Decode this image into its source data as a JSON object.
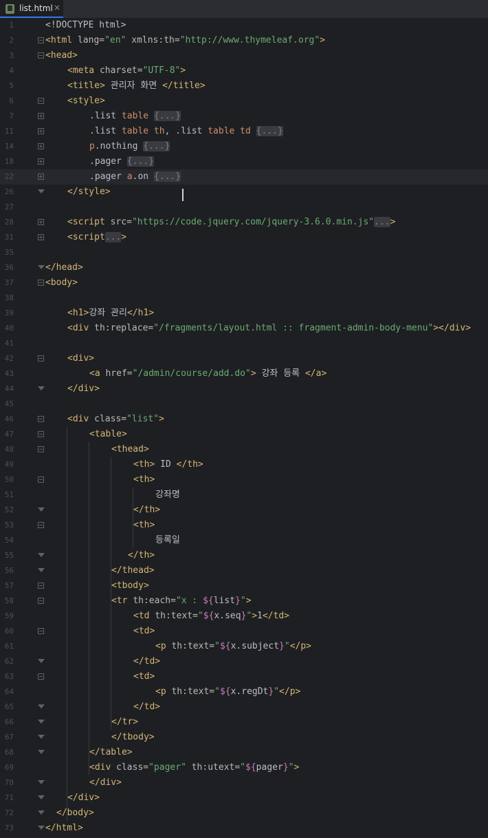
{
  "tab": {
    "filename": "list.html",
    "close": "×"
  },
  "lines": [
    {
      "n": "1",
      "segs": [
        [
          "t-text",
          "<!DOCTYPE html>"
        ]
      ],
      "indent": 0,
      "fold": ""
    },
    {
      "n": "2",
      "segs": [
        [
          "t-tag",
          "<html "
        ],
        [
          "t-attr",
          "lang="
        ],
        [
          "t-val",
          "\"en\""
        ],
        [
          "t-attr",
          " xmlns:th="
        ],
        [
          "t-val",
          "\"http://www.thymeleaf.org\""
        ],
        [
          "t-tag",
          ">"
        ]
      ],
      "indent": 0,
      "fold": "open"
    },
    {
      "n": "3",
      "segs": [
        [
          "t-tag",
          "<head>"
        ]
      ],
      "indent": 0,
      "fold": "open"
    },
    {
      "n": "4",
      "segs": [
        [
          "t-tag",
          "<meta "
        ],
        [
          "t-attr",
          "charset="
        ],
        [
          "t-val",
          "\"UTF-8\""
        ],
        [
          "t-tag",
          ">"
        ]
      ],
      "indent": 1,
      "fold": ""
    },
    {
      "n": "5",
      "segs": [
        [
          "t-tag",
          "<title>"
        ],
        [
          "t-text",
          " 관리자 화면 "
        ],
        [
          "t-tag",
          "</title>"
        ]
      ],
      "indent": 1,
      "fold": ""
    },
    {
      "n": "6",
      "segs": [
        [
          "t-tag",
          "<style>"
        ]
      ],
      "indent": 1,
      "fold": "open"
    },
    {
      "n": "7",
      "segs": [
        [
          "t-cls",
          ".list "
        ],
        [
          "t-kw",
          "table"
        ],
        [
          "t-text",
          " "
        ],
        [
          "t-fold",
          "{...}"
        ]
      ],
      "indent": 2,
      "fold": "closed"
    },
    {
      "n": "11",
      "segs": [
        [
          "t-cls",
          ".list "
        ],
        [
          "t-kw",
          "table th"
        ],
        [
          "t-text",
          ", "
        ],
        [
          "t-cls",
          ".list "
        ],
        [
          "t-kw",
          "table td"
        ],
        [
          "t-text",
          " "
        ],
        [
          "t-fold",
          "{...}"
        ]
      ],
      "indent": 2,
      "fold": "closed"
    },
    {
      "n": "14",
      "segs": [
        [
          "t-kw",
          "p"
        ],
        [
          "t-cls",
          ".nothing"
        ],
        [
          "t-text",
          " "
        ],
        [
          "t-fold",
          "{...}"
        ]
      ],
      "indent": 2,
      "fold": "closed"
    },
    {
      "n": "18",
      "segs": [
        [
          "t-cls",
          ".pager"
        ],
        [
          "t-text",
          " "
        ],
        [
          "t-fold",
          "{...}"
        ]
      ],
      "indent": 2,
      "fold": "closed"
    },
    {
      "n": "22",
      "segs": [
        [
          "t-cls",
          ".pager "
        ],
        [
          "t-kw",
          "a"
        ],
        [
          "t-cls",
          ".on"
        ],
        [
          "t-text",
          " "
        ],
        [
          "t-fold",
          "{...}"
        ]
      ],
      "indent": 2,
      "fold": "closed",
      "current": true
    },
    {
      "n": "26",
      "segs": [
        [
          "t-tag",
          "</style>"
        ]
      ],
      "indent": 1,
      "fold": "end"
    },
    {
      "n": "27",
      "segs": [],
      "indent": 0,
      "fold": ""
    },
    {
      "n": "28",
      "segs": [
        [
          "t-tag",
          "<script "
        ],
        [
          "t-attr",
          "src="
        ],
        [
          "t-val",
          "\"https://code.jquery.com/jquery-3.6.0.min.js\""
        ],
        [
          "t-fold",
          "..."
        ],
        [
          "t-tag",
          ">"
        ]
      ],
      "indent": 1,
      "fold": "closed"
    },
    {
      "n": "31",
      "segs": [
        [
          "t-tag",
          "<script"
        ],
        [
          "t-fold",
          "..."
        ],
        [
          "t-tag",
          ">"
        ]
      ],
      "indent": 1,
      "fold": "closed"
    },
    {
      "n": "35",
      "segs": [],
      "indent": 0,
      "fold": ""
    },
    {
      "n": "36",
      "segs": [
        [
          "t-tag",
          "</head>"
        ]
      ],
      "indent": 0,
      "fold": "end"
    },
    {
      "n": "37",
      "segs": [
        [
          "t-tag",
          "<body>"
        ]
      ],
      "indent": 0,
      "fold": "open"
    },
    {
      "n": "38",
      "segs": [],
      "indent": 0,
      "fold": ""
    },
    {
      "n": "39",
      "segs": [
        [
          "t-tag",
          "<h1>"
        ],
        [
          "t-text",
          "강좌 관리"
        ],
        [
          "t-tag",
          "</h1>"
        ]
      ],
      "indent": 1,
      "fold": ""
    },
    {
      "n": "40",
      "segs": [
        [
          "t-tag",
          "<div "
        ],
        [
          "t-attr",
          "th:replace="
        ],
        [
          "t-val",
          "\"/fragments/layout.html :: fragment-admin-body-menu\""
        ],
        [
          "t-tag",
          "></div>"
        ]
      ],
      "indent": 1,
      "fold": ""
    },
    {
      "n": "41",
      "segs": [],
      "indent": 0,
      "fold": ""
    },
    {
      "n": "42",
      "segs": [
        [
          "t-tag",
          "<div>"
        ]
      ],
      "indent": 1,
      "fold": "open"
    },
    {
      "n": "43",
      "segs": [
        [
          "t-tag",
          "<a "
        ],
        [
          "t-attr",
          "href="
        ],
        [
          "t-val",
          "\"/admin/course/add.do\""
        ],
        [
          "t-tag",
          ">"
        ],
        [
          "t-text",
          " 강좌 등록 "
        ],
        [
          "t-tag",
          "</a>"
        ]
      ],
      "indent": 2,
      "fold": ""
    },
    {
      "n": "44",
      "segs": [
        [
          "t-tag",
          "</div>"
        ]
      ],
      "indent": 1,
      "fold": "end"
    },
    {
      "n": "45",
      "segs": [],
      "indent": 0,
      "fold": ""
    },
    {
      "n": "46",
      "segs": [
        [
          "t-tag",
          "<div "
        ],
        [
          "t-attr",
          "class="
        ],
        [
          "t-val",
          "\"list\""
        ],
        [
          "t-tag",
          ">"
        ]
      ],
      "indent": 1,
      "fold": "open"
    },
    {
      "n": "47",
      "segs": [
        [
          "t-tag",
          "<table>"
        ]
      ],
      "indent": 2,
      "fold": "open"
    },
    {
      "n": "48",
      "segs": [
        [
          "t-tag",
          "<thead>"
        ]
      ],
      "indent": 3,
      "fold": "open"
    },
    {
      "n": "49",
      "segs": [
        [
          "t-tag",
          "<th>"
        ],
        [
          "t-text",
          " ID "
        ],
        [
          "t-tag",
          "</th>"
        ]
      ],
      "indent": 4,
      "fold": ""
    },
    {
      "n": "50",
      "segs": [
        [
          "t-tag",
          "<th>"
        ]
      ],
      "indent": 4,
      "fold": "open"
    },
    {
      "n": "51",
      "segs": [
        [
          "t-text",
          "강좌명"
        ]
      ],
      "indent": 5,
      "fold": ""
    },
    {
      "n": "52",
      "segs": [
        [
          "t-tag",
          "</th>"
        ]
      ],
      "indent": 4,
      "fold": "end"
    },
    {
      "n": "53",
      "segs": [
        [
          "t-tag",
          "<th>"
        ]
      ],
      "indent": 4,
      "fold": "open"
    },
    {
      "n": "54",
      "segs": [
        [
          "t-text",
          "등록일"
        ]
      ],
      "indent": 5,
      "fold": ""
    },
    {
      "n": "55",
      "segs": [
        [
          "t-tag",
          "</th>"
        ]
      ],
      "indent": 3.75,
      "fold": "end"
    },
    {
      "n": "56",
      "segs": [
        [
          "t-tag",
          "</thead>"
        ]
      ],
      "indent": 3,
      "fold": "end"
    },
    {
      "n": "57",
      "segs": [
        [
          "t-tag",
          "<tbody>"
        ]
      ],
      "indent": 3,
      "fold": "open"
    },
    {
      "n": "58",
      "segs": [
        [
          "t-tag",
          "<tr "
        ],
        [
          "t-attr",
          "th:each="
        ],
        [
          "t-val",
          "\"x : "
        ],
        [
          "t-pink",
          "${"
        ],
        [
          "t-text",
          "list"
        ],
        [
          "t-pink",
          "}"
        ],
        [
          "t-val",
          "\""
        ],
        [
          "t-tag",
          ">"
        ]
      ],
      "indent": 3,
      "fold": "open"
    },
    {
      "n": "59",
      "segs": [
        [
          "t-tag",
          "<td "
        ],
        [
          "t-attr",
          "th:text="
        ],
        [
          "t-val",
          "\""
        ],
        [
          "t-pink",
          "${"
        ],
        [
          "t-text",
          "x.seq"
        ],
        [
          "t-pink",
          "}"
        ],
        [
          "t-val",
          "\""
        ],
        [
          "t-tag",
          ">"
        ],
        [
          "t-text",
          "1"
        ],
        [
          "t-tag",
          "</td>"
        ]
      ],
      "indent": 4,
      "fold": ""
    },
    {
      "n": "60",
      "segs": [
        [
          "t-tag",
          "<td>"
        ]
      ],
      "indent": 4,
      "fold": "open"
    },
    {
      "n": "61",
      "segs": [
        [
          "t-tag",
          "<p "
        ],
        [
          "t-attr",
          "th:text="
        ],
        [
          "t-val",
          "\""
        ],
        [
          "t-pink",
          "${"
        ],
        [
          "t-text",
          "x.subject"
        ],
        [
          "t-pink",
          "}"
        ],
        [
          "t-val",
          "\""
        ],
        [
          "t-tag",
          "</p>"
        ]
      ],
      "indent": 5,
      "fold": ""
    },
    {
      "n": "62",
      "segs": [
        [
          "t-tag",
          "</td>"
        ]
      ],
      "indent": 4,
      "fold": "end"
    },
    {
      "n": "63",
      "segs": [
        [
          "t-tag",
          "<td>"
        ]
      ],
      "indent": 4,
      "fold": "open"
    },
    {
      "n": "64",
      "segs": [
        [
          "t-tag",
          "<p "
        ],
        [
          "t-attr",
          "th:text="
        ],
        [
          "t-val",
          "\""
        ],
        [
          "t-pink",
          "${"
        ],
        [
          "t-text",
          "x.regDt"
        ],
        [
          "t-pink",
          "}"
        ],
        [
          "t-val",
          "\""
        ],
        [
          "t-tag",
          "</p>"
        ]
      ],
      "indent": 5,
      "fold": ""
    },
    {
      "n": "65",
      "segs": [
        [
          "t-tag",
          "</td>"
        ]
      ],
      "indent": 4,
      "fold": "end"
    },
    {
      "n": "66",
      "segs": [
        [
          "t-tag",
          "</tr>"
        ]
      ],
      "indent": 3,
      "fold": "end"
    },
    {
      "n": "67",
      "segs": [
        [
          "t-tag",
          "</tbody>"
        ]
      ],
      "indent": 3,
      "fold": "end"
    },
    {
      "n": "68",
      "segs": [
        [
          "t-tag",
          "</table>"
        ]
      ],
      "indent": 2,
      "fold": "end"
    },
    {
      "n": "69",
      "segs": [
        [
          "t-tag",
          "<div "
        ],
        [
          "t-attr",
          "class="
        ],
        [
          "t-val",
          "\"pager\""
        ],
        [
          "t-attr",
          " th:utext="
        ],
        [
          "t-val",
          "\""
        ],
        [
          "t-pink",
          "${"
        ],
        [
          "t-text",
          "pager"
        ],
        [
          "t-pink",
          "}"
        ],
        [
          "t-val",
          "\""
        ],
        [
          "t-tag",
          ">"
        ]
      ],
      "indent": 2,
      "fold": ""
    },
    {
      "n": "70",
      "segs": [
        [
          "t-tag",
          "</div>"
        ]
      ],
      "indent": 2,
      "fold": "end"
    },
    {
      "n": "71",
      "segs": [
        [
          "t-tag",
          "</div>"
        ]
      ],
      "indent": 1,
      "fold": "end"
    },
    {
      "n": "72",
      "segs": [
        [
          "t-tag",
          "</body>"
        ]
      ],
      "indent": 0.5,
      "fold": "end"
    },
    {
      "n": "73",
      "segs": [
        [
          "t-tag",
          "</html>"
        ]
      ],
      "indent": 0,
      "fold": "end"
    }
  ]
}
